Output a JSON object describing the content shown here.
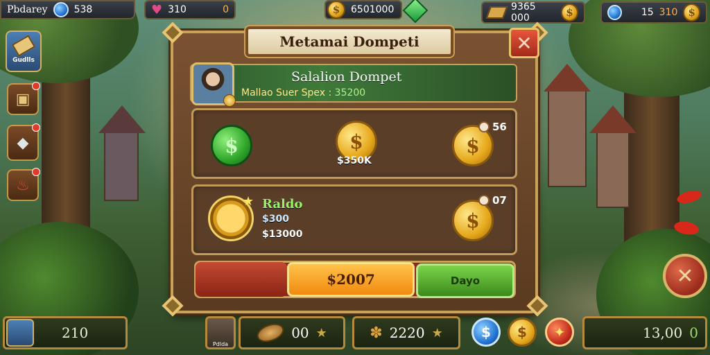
{
  "topbar": {
    "player_name": "Pbdarey",
    "gems": "538",
    "energy": "310",
    "energy_extra": "0",
    "gold": "6501000",
    "right_value": "9365 000",
    "right_count": "15",
    "right_count2": "310"
  },
  "sidebar": {
    "top_button_label": "Gudlls"
  },
  "dialog": {
    "title": "Metamai Dompeti",
    "close_icon": "close-x-icon",
    "header_title": "Salalion Dompet",
    "header_subtitle": "Mallao Suer Spex : ",
    "header_value": "35200",
    "row1": {
      "coin2_value": "$350K",
      "coin3_badge": "56"
    },
    "row2": {
      "label": "Raldo",
      "amount": "$300",
      "total": "$13000",
      "coin_badge": "07"
    },
    "orange_button": "$2007",
    "green_button": "Dayo"
  },
  "bottombar": {
    "left_value": "210",
    "slot1_value": "00",
    "slot2_value": "2220",
    "right_value": "13,00",
    "right_suffix": "0",
    "portrait_caption": "Pdlda"
  },
  "colors": {
    "panel_brown": "#5a3a20",
    "gold_border": "#c9a25a",
    "header_green": "#3f7a3a",
    "orange_button": "#f08a10",
    "green_button": "#3a8a1c",
    "close_red": "#a12a1a"
  }
}
